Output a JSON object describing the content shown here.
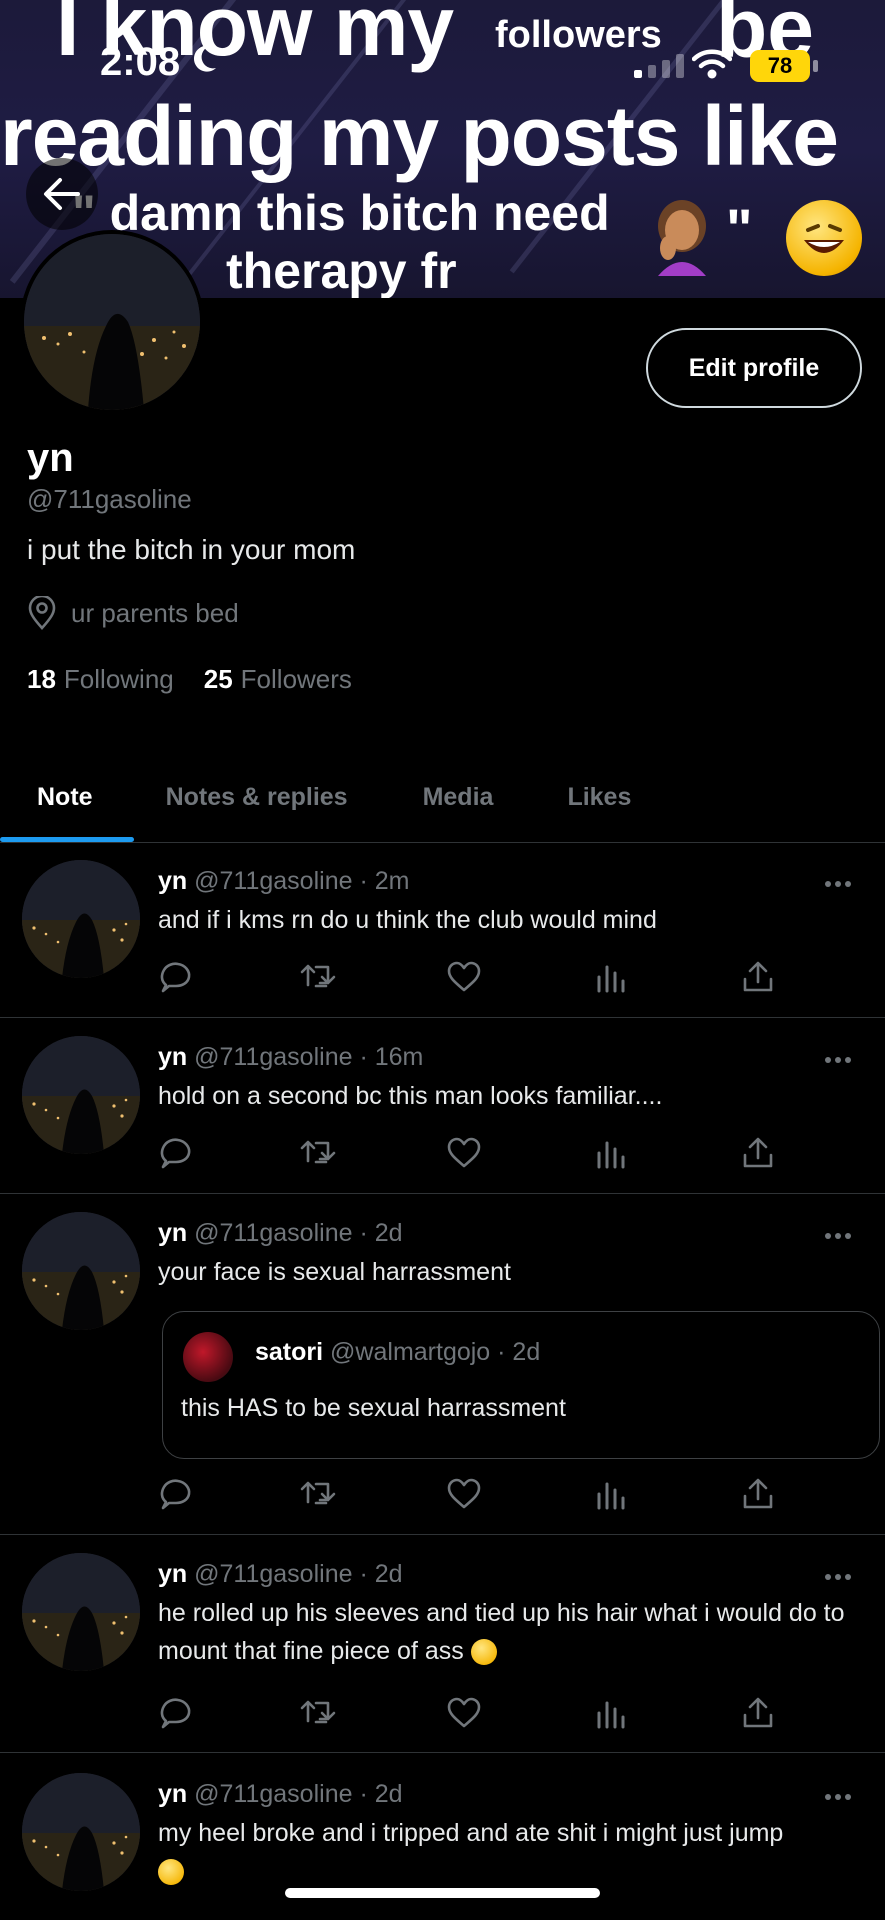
{
  "status_bar": {
    "time": "2:08",
    "battery": "78"
  },
  "banner": {
    "line1": "I know my",
    "line1_small": "followers",
    "line1_end": "be",
    "line2": "reading my posts like",
    "line3": "\" damn this bitch need",
    "line4": "therapy fr",
    "quote_close": "\""
  },
  "profile": {
    "edit_label": "Edit profile",
    "name": "yn",
    "handle": "@711gasoline",
    "bio": "i put the bitch in your mom",
    "location": "ur parents bed",
    "following_count": "18",
    "following_label": "Following",
    "followers_count": "25",
    "followers_label": "Followers"
  },
  "tabs": [
    {
      "label": "Note"
    },
    {
      "label": "Notes & replies"
    },
    {
      "label": "Media"
    },
    {
      "label": "Likes"
    }
  ],
  "tweets": [
    {
      "name": "yn",
      "meta": "@711gasoline · 2m",
      "text": "and if i kms rn do u think the club would mind"
    },
    {
      "name": "yn",
      "meta": "@711gasoline · 16m",
      "text": "hold on a second bc this man looks familiar...."
    },
    {
      "name": "yn",
      "meta": "@711gasoline · 2d",
      "text": "your face is sexual harrassment",
      "quote": {
        "name": "satori",
        "meta": "@walmartgojo · 2d",
        "text": "this HAS to be sexual harrassment"
      }
    },
    {
      "name": "yn",
      "meta": "@711gasoline · 2d",
      "text": "he rolled up his sleeves and tied up his hair what i would do to mount that fine piece of ass"
    },
    {
      "name": "yn",
      "meta": "@711gasoline · 2d",
      "text": "my heel broke and i tripped and ate shit i might just jump"
    }
  ],
  "colors": {
    "accent": "#1d9bf0",
    "battery": "#ffd60a",
    "muted": "#71767b"
  }
}
